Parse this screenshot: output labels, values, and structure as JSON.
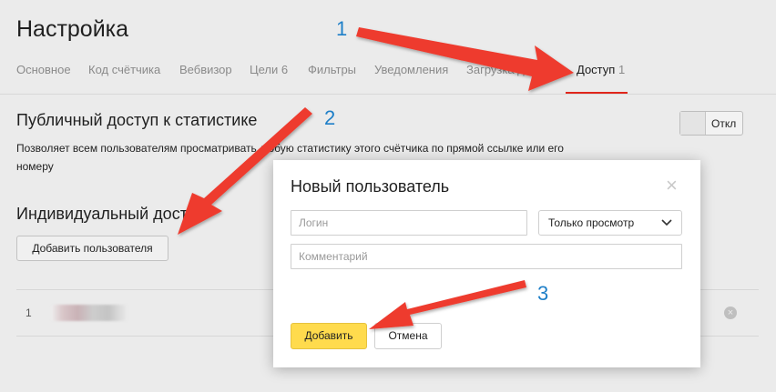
{
  "page": {
    "title": "Настройка"
  },
  "tabs": [
    {
      "label": "Основное",
      "count": ""
    },
    {
      "label": "Код счётчика",
      "count": ""
    },
    {
      "label": "Вебвизор",
      "count": ""
    },
    {
      "label": "Цели",
      "count": "6"
    },
    {
      "label": "Фильтры",
      "count": ""
    },
    {
      "label": "Уведомления",
      "count": ""
    },
    {
      "label": "Загрузка д",
      "count": ""
    },
    {
      "label": "Доступ",
      "count": "1"
    }
  ],
  "public_access": {
    "heading": "Публичный доступ к статистике",
    "description": "Позволяет всем пользователям просматривать любую статистику этого счётчика по прямой ссылке или его номеру",
    "toggle_label": "Откл"
  },
  "individual_access": {
    "heading": "Индивидуальный досту",
    "add_user_label": "Добавить пользователя",
    "rows": [
      {
        "num": "1"
      }
    ]
  },
  "modal": {
    "title": "Новый пользователь",
    "close": "×",
    "login_placeholder": "Логин",
    "role_selected": "Только просмотр",
    "comment_placeholder": "Комментарий",
    "add_label": "Добавить",
    "cancel_label": "Отмена"
  },
  "annotations": [
    "1",
    "2",
    "3"
  ],
  "colors": {
    "accent_red": "#e0261b",
    "button_yellow": "#ffdb4d",
    "annotation_blue": "#1e7fc8",
    "arrow_red": "#ee3b2e"
  }
}
